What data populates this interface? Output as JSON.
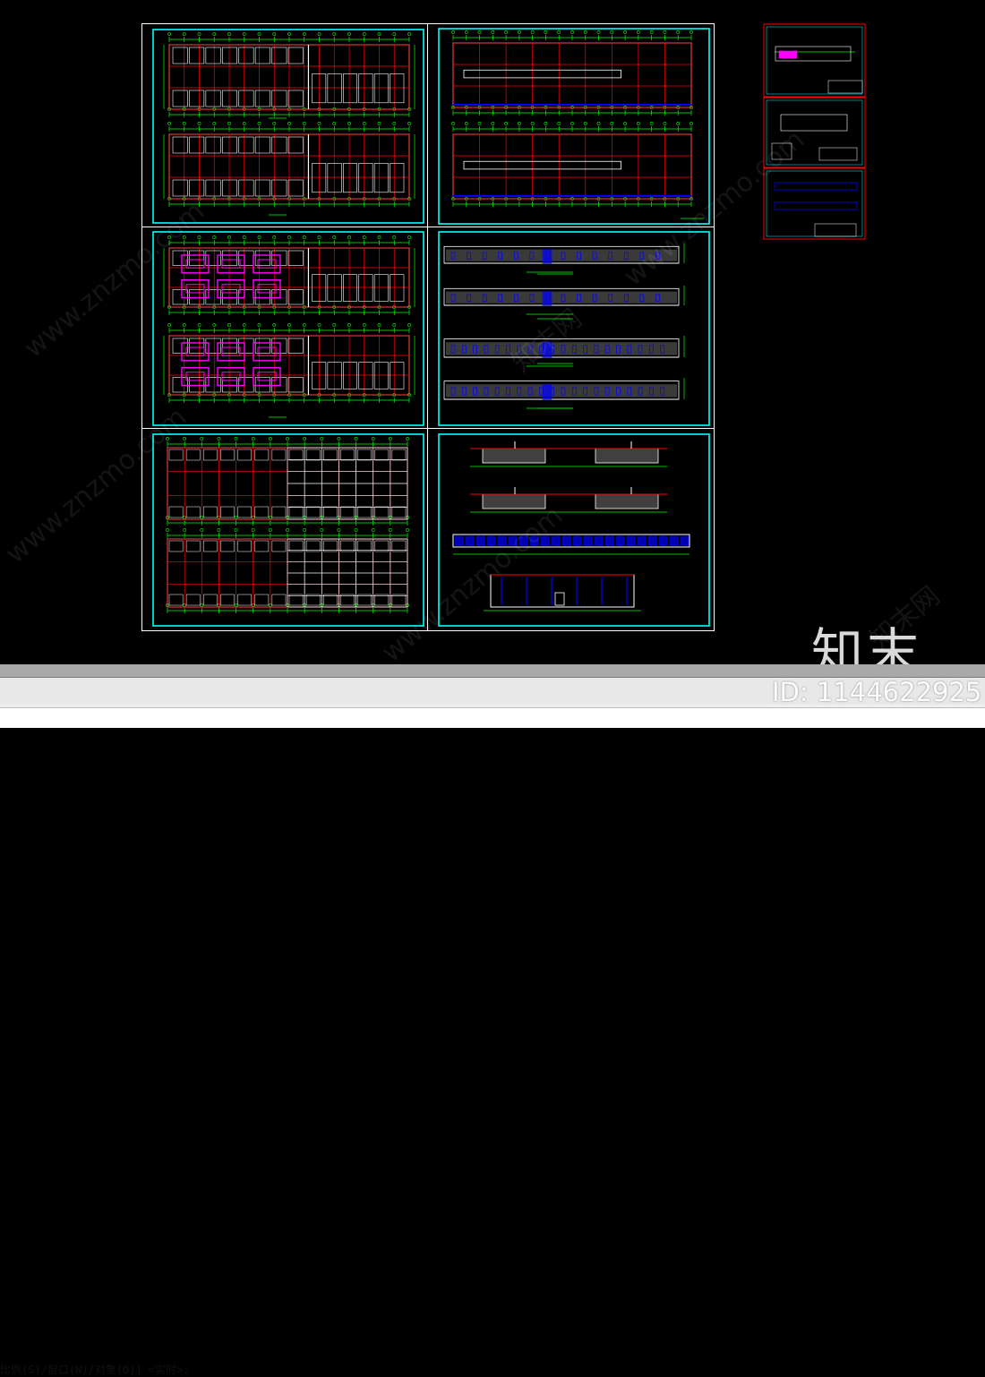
{
  "command_line": {
    "prompt": "比例(S)/窗口(W)/对象(O)] <实时>:",
    "input_value": ""
  },
  "watermarks": {
    "site": "www.znzmo.com",
    "brand": "知末网"
  },
  "logo": {
    "text": "知末"
  },
  "image_id": "ID: 1144622925",
  "colors": {
    "background": "#000000",
    "sheet_frame": "#ffffff",
    "title_border": "#00ffff",
    "axis_lines": "#ff0000",
    "dimensions": "#00ff00",
    "walls": "#ffffff",
    "furniture": "#ff00ff",
    "windows": "#0000ff",
    "hatch": "#808080"
  },
  "drawing_sheets": [
    {
      "name": "first-floor-plan",
      "kind": "plan"
    },
    {
      "name": "roof-plan",
      "kind": "roof"
    },
    {
      "name": "furniture-plan",
      "kind": "plan-furniture"
    },
    {
      "name": "elevations",
      "kind": "elevation"
    },
    {
      "name": "axis-grid-plan",
      "kind": "grid"
    },
    {
      "name": "sections",
      "kind": "section"
    }
  ]
}
